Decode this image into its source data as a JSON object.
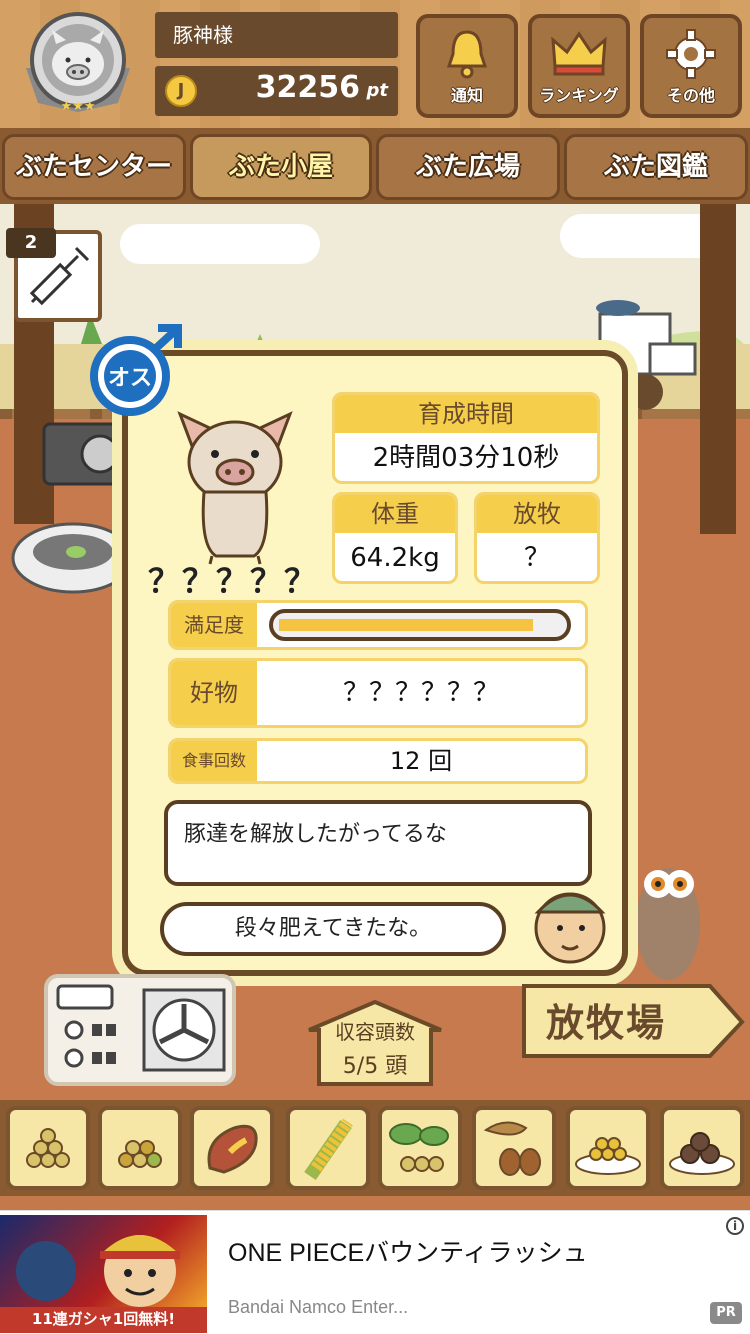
{
  "header": {
    "username": "豚神様",
    "points": "32256",
    "points_unit": "pt",
    "coin_symbol": "J",
    "buttons": [
      {
        "label": "通知",
        "icon": "bell-icon"
      },
      {
        "label": "ランキング",
        "icon": "crown-icon"
      },
      {
        "label": "その他",
        "icon": "gear-icon"
      }
    ]
  },
  "tabs": [
    {
      "label": "ぶたセンター",
      "active": false
    },
    {
      "label": "ぶた小屋",
      "active": true
    },
    {
      "label": "ぶた広場",
      "active": false
    },
    {
      "label": "ぶた図鑑",
      "active": false
    }
  ],
  "badge": {
    "count": "2",
    "icon": "syringe-icon"
  },
  "pig": {
    "gender_label": "オス",
    "name": "？？？？？",
    "growth_time_label": "育成時間",
    "growth_time": "2時間03分10秒",
    "weight_label": "体重",
    "weight": "64.2kg",
    "grazing_label": "放牧",
    "grazing": "？",
    "satisfaction_label": "満足度",
    "satisfaction": 0.9,
    "favorite_label": "好物",
    "favorite": "？？？？？？",
    "meals_label": "食事回数",
    "meals": "12 回"
  },
  "speech": {
    "message": "豚達を解放したがってるな",
    "reply": "段々肥えてきたな。"
  },
  "capacity": {
    "title": "収容頭数",
    "value": "5/5 頭"
  },
  "pasture_sign": "放牧場",
  "food_items": [
    "beans-pile-icon",
    "mixed-beans-icon",
    "sweet-potato-icon",
    "corn-icon",
    "soybean-plant-icon",
    "acorn-icon",
    "bean-plate-icon",
    "meatball-plate-icon"
  ],
  "ad": {
    "title": "ONE PIECEバウンティラッシュ",
    "advertiser": "Bandai Namco Enter...",
    "pr_label": "PR",
    "info_symbol": "i",
    "image_text": "11連ガシャ1回無料!"
  },
  "colors": {
    "accent_yellow": "#f5cf4b",
    "wood": "#6b4a28",
    "card_bg": "#fdf6c2",
    "gender_blue": "#1f6fc0"
  }
}
